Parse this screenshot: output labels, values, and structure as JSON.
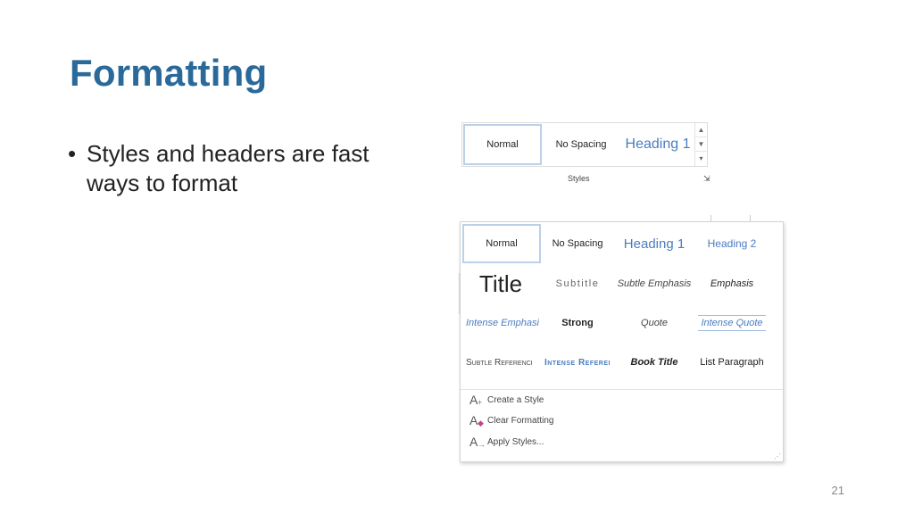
{
  "slide": {
    "title": "Formatting",
    "bullet": "Styles and headers are fast ways to format",
    "page_number": "21"
  },
  "ribbon": {
    "styles": [
      "Normal",
      "No Spacing",
      "Heading 1"
    ],
    "group_label": "Styles"
  },
  "gallery": {
    "row1": [
      "Normal",
      "No Spacing",
      "Heading 1",
      "Heading 2"
    ],
    "row2": [
      "Title",
      "Subtitle",
      "Subtle Emphasis",
      "Emphasis"
    ],
    "row3": [
      "Intense Emphasi",
      "Strong",
      "Quote",
      "Intense Quote"
    ],
    "row4": [
      "Subtle Referenci",
      "Intense Referei",
      "Book Title",
      "List Paragraph"
    ],
    "menu": [
      "Create a Style",
      "Clear Formatting",
      "Apply Styles..."
    ]
  },
  "colors": {
    "title": "#2a6a9a",
    "heading_blue": "#4a7dbf",
    "selected_border": "#bcd0e8"
  }
}
